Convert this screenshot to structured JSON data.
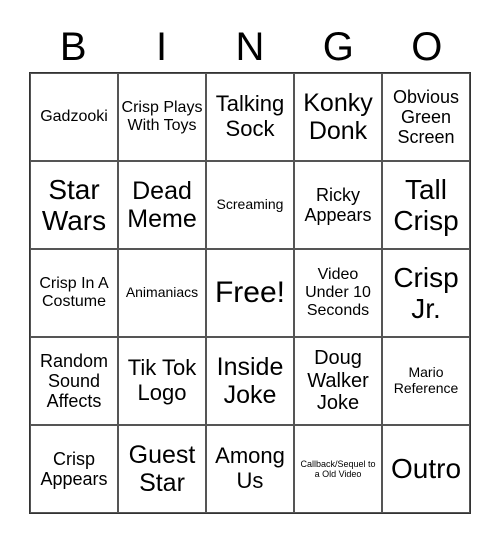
{
  "header": [
    "B",
    "I",
    "N",
    "G",
    "O"
  ],
  "cells": [
    {
      "text": "Gadzooki",
      "size": "s16"
    },
    {
      "text": "Crisp Plays With Toys",
      "size": "s16"
    },
    {
      "text": "Talking Sock",
      "size": "s22"
    },
    {
      "text": "Konky Donk",
      "size": "s25"
    },
    {
      "text": "Obvious Green Screen",
      "size": "s18"
    },
    {
      "text": "Star Wars",
      "size": "s28"
    },
    {
      "text": "Dead Meme",
      "size": "s25"
    },
    {
      "text": "Screaming",
      "size": "s14"
    },
    {
      "text": "Ricky Appears",
      "size": "s18"
    },
    {
      "text": "Tall Crisp",
      "size": "s28"
    },
    {
      "text": "Crisp In A Costume",
      "size": "s16"
    },
    {
      "text": "Animaniacs",
      "size": "s14"
    },
    {
      "text": "Free!",
      "size": "s30"
    },
    {
      "text": "Video Under 10 Seconds",
      "size": "s16"
    },
    {
      "text": "Crisp Jr.",
      "size": "s28"
    },
    {
      "text": "Random Sound Affects",
      "size": "s18"
    },
    {
      "text": "Tik Tok Logo",
      "size": "s22"
    },
    {
      "text": "Inside Joke",
      "size": "s25"
    },
    {
      "text": "Doug Walker Joke",
      "size": "s20"
    },
    {
      "text": "Mario Reference",
      "size": "s14"
    },
    {
      "text": "Crisp Appears",
      "size": "s18"
    },
    {
      "text": "Guest Star",
      "size": "s25"
    },
    {
      "text": "Among Us",
      "size": "s22"
    },
    {
      "text": "Callback/Sequel to a Old Video",
      "size": "s9"
    },
    {
      "text": "Outro",
      "size": "s28"
    }
  ]
}
